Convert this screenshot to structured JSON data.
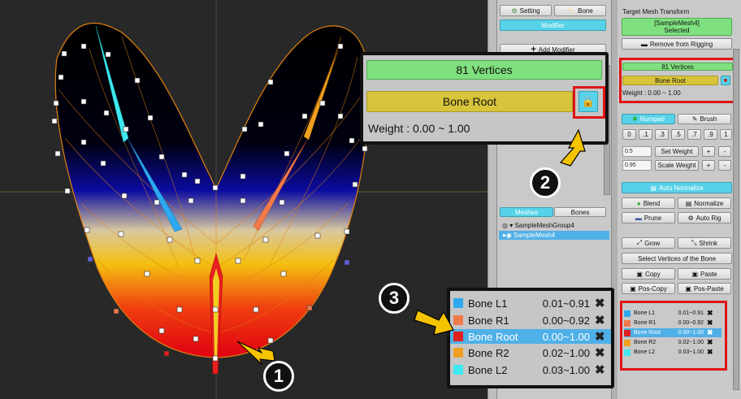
{
  "callout_numbers": [
    "1",
    "2",
    "3"
  ],
  "mid_panel": {
    "tabs": [
      "Setting",
      "Bone"
    ],
    "modifier_label": "Modifier",
    "add_modifier_label": "Add Modifier",
    "hierarchy_tabs": [
      "Meshes",
      "Bones"
    ],
    "tree": [
      "SampleMeshGroup4",
      "SampleMesh4"
    ]
  },
  "right_panel": {
    "target_title": "Target Mesh Transform",
    "selected_line1": "[SampleMesh4]",
    "selected_line2": "Selected",
    "remove_rigging": "Remove from Rigging",
    "vertices": "81 Vertices",
    "bone_root": "Bone Root",
    "weight": "Weight : 0.00 ~ 1.00",
    "numpad": "Numpad",
    "brush": "Brush",
    "numpad_keys": [
      "0",
      ".1",
      ".3",
      ".5",
      ".7",
      ".9",
      "1"
    ],
    "set_weight_value": "0.5",
    "set_weight": "Set Weight",
    "scale_weight_value": "0.95",
    "scale_weight": "Scale Weight",
    "plus": "+",
    "minus": "-",
    "auto_normalize": "Auto Normalize",
    "blend": "Blend",
    "normalize": "Normalize",
    "prune": "Prune",
    "auto_rig": "Auto Rig",
    "grow": "Grow",
    "shrink": "Shrink",
    "select_vertices": "Select Vertices of the Bone",
    "copy": "Copy",
    "paste": "Paste",
    "pos_copy": "Pos-Copy",
    "pos_paste": "Pos-Paste",
    "bones": [
      {
        "name": "Bone L1",
        "range": "0.01~0.91",
        "color": "#2ea8f0"
      },
      {
        "name": "Bone R1",
        "range": "0.00~0.92",
        "color": "#f07a4a"
      },
      {
        "name": "Bone Root",
        "range": "0.00~1.00",
        "color": "#e02020"
      },
      {
        "name": "Bone R2",
        "range": "0.02~1.00",
        "color": "#f0a020"
      },
      {
        "name": "Bone L2",
        "range": "0.03~1.00",
        "color": "#40e8f0"
      }
    ]
  },
  "popup_weight": {
    "vertices": "81 Vertices",
    "bone_root": "Bone Root",
    "weight": "Weight : 0.00 ~ 1.00"
  },
  "popup_bones": [
    {
      "name": "Bone L1",
      "range": "0.01~0.91",
      "color": "#2ea8f0"
    },
    {
      "name": "Bone R1",
      "range": "0.00~0.92",
      "color": "#f07a4a"
    },
    {
      "name": "Bone Root",
      "range": "0.00~1.00",
      "color": "#e02020"
    },
    {
      "name": "Bone R2",
      "range": "0.02~1.00",
      "color": "#f0a020"
    },
    {
      "name": "Bone L2",
      "range": "0.03~1.00",
      "color": "#40e8f0"
    }
  ],
  "icons": [
    "lock-icon",
    "close-icon",
    "gear-icon",
    "bone-icon",
    "eye-icon"
  ],
  "colors": {
    "accent_cyan": "#57d2e8",
    "green": "#7fe07f",
    "yellow": "#d8c43a",
    "highlight_red": "#e01515",
    "arrow_yellow": "#f5c400",
    "selected_row": "#4fb0e8"
  }
}
